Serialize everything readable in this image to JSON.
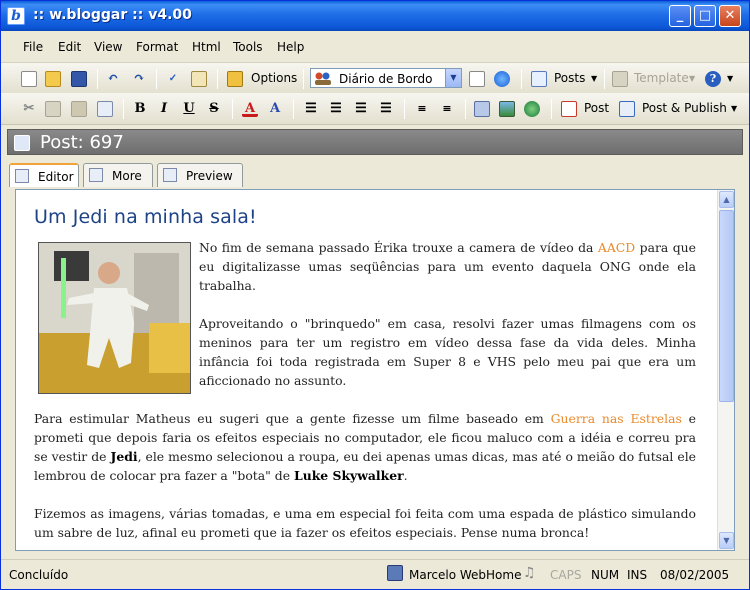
{
  "window": {
    "title": ":: w.bloggar :: v4.00"
  },
  "menu": [
    "File",
    "Edit",
    "View",
    "Format",
    "Html",
    "Tools",
    "Help"
  ],
  "toolbar": {
    "options_label": "Options",
    "blog_select": "Diário de Bordo",
    "posts_label": "Posts",
    "template_label": "Template",
    "post_label": "Post",
    "post_publish_label": "Post & Publish"
  },
  "post_header": {
    "title": "Post: 697"
  },
  "tabs": [
    {
      "label": "Editor",
      "active": true
    },
    {
      "label": "More",
      "active": false
    },
    {
      "label": "Preview",
      "active": false
    }
  ],
  "document": {
    "heading": "Um Jedi na minha sala!",
    "p1_a": "No fim de semana passado Érika trouxe a camera de vídeo da ",
    "p1_link": "AACD",
    "p1_b": " para que eu digitalizasse umas seqüências para um evento daquela ONG onde ela trabalha.",
    "p2": "Aproveitando o \"brinquedo\" em casa, resolvi fazer umas filmagens com os meninos para ter um registro em vídeo dessa fase da vida deles. Minha infância foi toda registrada em Super 8 e VHS pelo meu pai que era um aficcionado no assunto.",
    "p3_a": "Para estimular Matheus eu sugeri que a gente fizesse um filme baseado em ",
    "p3_link": "Guerra nas Estrelas",
    "p3_b": " e prometi que depois faria os efeitos especiais no computador, ele ficou maluco com a idéia e correu pra se vestir de ",
    "p3_bold1": "Jedi",
    "p3_c": ", ele mesmo selecionou a roupa, eu dei apenas umas dicas, mas até o meião do futsal ele lembrou de colocar pra fazer a \"bota\" de ",
    "p3_bold2": "Luke Skywalker",
    "p3_d": ".",
    "p4": "Fizemos as imagens, várias tomadas, e uma em especial foi feita com uma espada de plástico simulando um sabre de luz, afinal eu prometi que ia fazer os efeitos especiais. Pense numa bronca!"
  },
  "status": {
    "left": "Concluído",
    "user": "Marcelo WebHome",
    "caps": "CAPS",
    "num": "NUM",
    "ins": "INS",
    "date": "08/02/2005"
  },
  "colors": {
    "title_bar": "#1f6ee8",
    "link": "#e88a2b",
    "heading": "#1d4386",
    "post_bar": "#7a7a7a"
  },
  "icons": [
    "app-logo-icon",
    "minimize-icon",
    "maximize-icon",
    "close-icon",
    "new-icon",
    "open-icon",
    "save-icon",
    "undo-icon",
    "redo-icon",
    "spellcheck-icon",
    "find-icon",
    "options-icon",
    "blog-icon",
    "posts-icon",
    "template-icon",
    "help-icon",
    "cut-icon",
    "copy-icon",
    "paste-icon",
    "paste-special-icon",
    "bold-icon",
    "italic-icon",
    "underline-icon",
    "strikethrough-icon",
    "font-color-icon",
    "font-icon",
    "align-left-icon",
    "align-center-icon",
    "align-right-icon",
    "justify-icon",
    "numbered-list-icon",
    "bullet-list-icon",
    "link-icon",
    "image-icon",
    "web-icon",
    "post-icon",
    "post-publish-icon",
    "user-icon",
    "music-icon"
  ]
}
